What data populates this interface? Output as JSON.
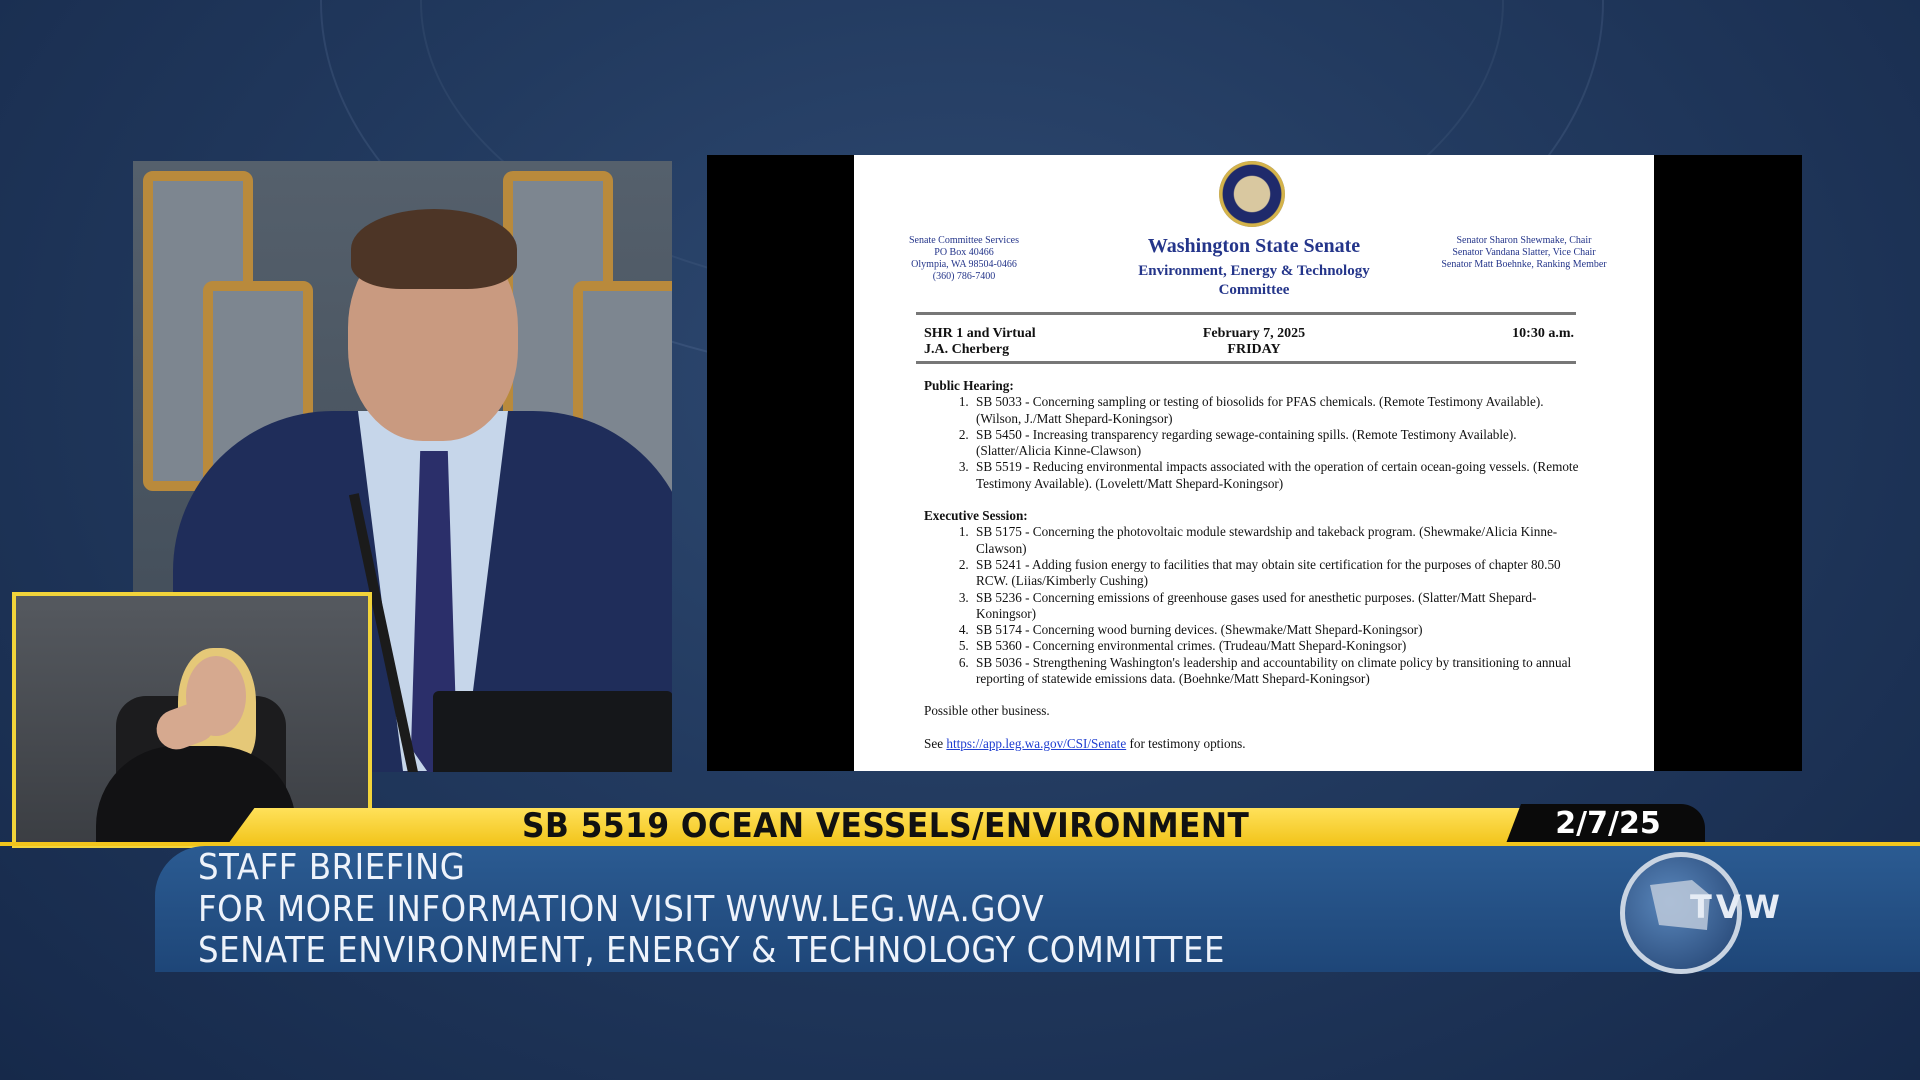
{
  "document": {
    "left_header": [
      "Senate Committee Services",
      "PO Box 40466",
      "Olympia, WA 98504-0466",
      "(360) 786-7400"
    ],
    "title": "Washington State Senate",
    "subtitle_line1": "Environment, Energy & Technology",
    "subtitle_line2": "Committee",
    "right_header": [
      "Senator Sharon Shewmake, Chair",
      "Senator Vandana Slatter, Vice Chair",
      "Senator Matt Boehnke, Ranking Member"
    ],
    "location_line1": "SHR 1 and Virtual",
    "location_line2": "J.A. Cherberg",
    "date": "February 7, 2025",
    "day": "FRIDAY",
    "time": "10:30  a.m.",
    "public_hearing_heading": "Public Hearing:",
    "public_hearing": [
      "SB 5033 - Concerning sampling or testing of biosolids for PFAS chemicals. (Remote Testimony Available). (Wilson, J./Matt Shepard-Koningsor)",
      "SB 5450 - Increasing transparency regarding sewage-containing spills. (Remote Testimony Available). (Slatter/Alicia Kinne-Clawson)",
      "SB 5519 - Reducing environmental impacts associated with the operation of certain ocean-going vessels. (Remote Testimony Available). (Lovelett/Matt Shepard-Koningsor)"
    ],
    "executive_session_heading": "Executive Session:",
    "executive_session": [
      "SB 5175 - Concerning the photovoltaic module stewardship and takeback program. (Shewmake/Alicia Kinne-Clawson)",
      "SB 5241 - Adding fusion energy to facilities that may obtain site certification for the purposes of chapter 80.50 RCW. (Liias/Kimberly Cushing)",
      "SB 5236 - Concerning emissions of greenhouse gases used for anesthetic purposes. (Slatter/Matt Shepard-Koningsor)",
      "SB 5174 - Concerning wood burning devices. (Shewmake/Matt Shepard-Koningsor)",
      "SB 5360 - Concerning environmental crimes. (Trudeau/Matt Shepard-Koningsor)",
      "SB 5036 - Strengthening Washington's leadership and accountability on climate policy by transitioning to annual reporting of statewide emissions data. (Boehnke/Matt Shepard-Koningsor)"
    ],
    "other_business": "Possible other business.",
    "see_prefix": "See ",
    "link": "https://app.leg.wa.gov/CSI/Senate",
    "see_suffix": " for testimony options."
  },
  "lower_third": {
    "ticker": "SB 5519 OCEAN VESSELS/ENVIRONMENT",
    "date": "2/7/25",
    "line1": "STAFF BRIEFING",
    "line2": "FOR MORE INFORMATION VISIT WWW.LEG.WA.GOV",
    "line3": "SENATE ENVIRONMENT, ENERGY & TECHNOLOGY COMMITTEE"
  },
  "logo": {
    "text": "TVW"
  },
  "colors": {
    "accent_yellow": "#f2c51c",
    "bar_blue": "#1e4678",
    "doc_blue": "#24358a"
  }
}
